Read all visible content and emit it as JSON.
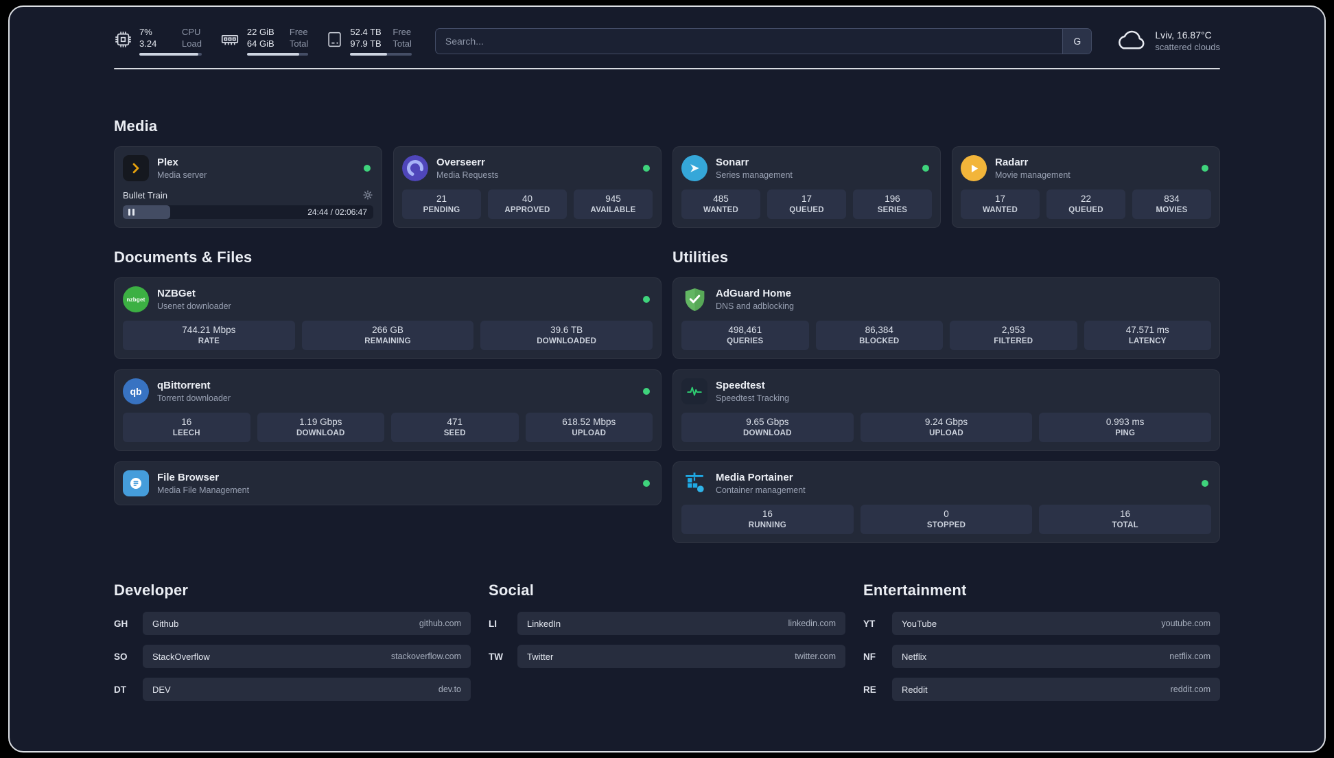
{
  "topbar": {
    "metrics": [
      {
        "icon": "cpu",
        "rows": [
          {
            "value": "7%",
            "label": "CPU"
          },
          {
            "value": "3.24",
            "label": "Load"
          }
        ],
        "bar_percent": 95
      },
      {
        "icon": "ram",
        "rows": [
          {
            "value": "22 GiB",
            "label": "Free"
          },
          {
            "value": "64 GiB",
            "label": "Total"
          }
        ],
        "bar_percent": 85
      },
      {
        "icon": "disk",
        "rows": [
          {
            "value": "52.4 TB",
            "label": "Free"
          },
          {
            "value": "97.9 TB",
            "label": "Total"
          }
        ],
        "bar_percent": 60
      }
    ],
    "search": {
      "placeholder": "Search...",
      "button_label": "G"
    },
    "weather": {
      "location": "Lviv, 16.87°C",
      "condition": "scattered clouds"
    }
  },
  "sections": {
    "media": {
      "title": "Media",
      "cards": [
        {
          "name": "Plex",
          "desc": "Media server",
          "icon": "plex",
          "online": true,
          "player": {
            "title": "Bullet Train",
            "time": "24:44 / 02:06:47",
            "progress_percent": 19
          }
        },
        {
          "name": "Overseerr",
          "desc": "Media Requests",
          "icon": "overseerr",
          "online": true,
          "stats": [
            {
              "value": "21",
              "label": "PENDING"
            },
            {
              "value": "40",
              "label": "APPROVED"
            },
            {
              "value": "945",
              "label": "AVAILABLE"
            }
          ]
        },
        {
          "name": "Sonarr",
          "desc": "Series management",
          "icon": "sonarr",
          "online": true,
          "stats": [
            {
              "value": "485",
              "label": "WANTED"
            },
            {
              "value": "17",
              "label": "QUEUED"
            },
            {
              "value": "196",
              "label": "SERIES"
            }
          ]
        },
        {
          "name": "Radarr",
          "desc": "Movie management",
          "icon": "radarr",
          "online": true,
          "stats": [
            {
              "value": "17",
              "label": "WANTED"
            },
            {
              "value": "22",
              "label": "QUEUED"
            },
            {
              "value": "834",
              "label": "MOVIES"
            }
          ]
        }
      ]
    },
    "documents": {
      "title": "Documents & Files",
      "cards": [
        {
          "name": "NZBGet",
          "desc": "Usenet downloader",
          "icon": "nzbget",
          "online": true,
          "stats": [
            {
              "value": "744.21 Mbps",
              "label": "RATE"
            },
            {
              "value": "266 GB",
              "label": "REMAINING"
            },
            {
              "value": "39.6 TB",
              "label": "DOWNLOADED"
            }
          ]
        },
        {
          "name": "qBittorrent",
          "desc": "Torrent downloader",
          "icon": "qbittorrent",
          "online": true,
          "stats": [
            {
              "value": "16",
              "label": "LEECH"
            },
            {
              "value": "1.19 Gbps",
              "label": "DOWNLOAD"
            },
            {
              "value": "471",
              "label": "SEED"
            },
            {
              "value": "618.52 Mbps",
              "label": "UPLOAD"
            }
          ]
        },
        {
          "name": "File Browser",
          "desc": "Media File Management",
          "icon": "filebrowser",
          "online": true
        }
      ]
    },
    "utilities": {
      "title": "Utilities",
      "cards": [
        {
          "name": "AdGuard Home",
          "desc": "DNS and adblocking",
          "icon": "adguard",
          "online": false,
          "stats": [
            {
              "value": "498,461",
              "label": "QUERIES"
            },
            {
              "value": "86,384",
              "label": "BLOCKED"
            },
            {
              "value": "2,953",
              "label": "FILTERED"
            },
            {
              "value": "47.571 ms",
              "label": "LATENCY"
            }
          ]
        },
        {
          "name": "Speedtest",
          "desc": "Speedtest Tracking",
          "icon": "speedtest",
          "online": false,
          "stats": [
            {
              "value": "9.65 Gbps",
              "label": "DOWNLOAD"
            },
            {
              "value": "9.24 Gbps",
              "label": "UPLOAD"
            },
            {
              "value": "0.993 ms",
              "label": "PING"
            }
          ]
        },
        {
          "name": "Media Portainer",
          "desc": "Container management",
          "icon": "portainer",
          "online": true,
          "stats": [
            {
              "value": "16",
              "label": "RUNNING"
            },
            {
              "value": "0",
              "label": "STOPPED"
            },
            {
              "value": "16",
              "label": "TOTAL"
            }
          ]
        }
      ]
    }
  },
  "link_sections": [
    {
      "title": "Developer",
      "items": [
        {
          "abbr": "GH",
          "name": "Github",
          "url": "github.com"
        },
        {
          "abbr": "SO",
          "name": "StackOverflow",
          "url": "stackoverflow.com"
        },
        {
          "abbr": "DT",
          "name": "DEV",
          "url": "dev.to"
        }
      ]
    },
    {
      "title": "Social",
      "items": [
        {
          "abbr": "LI",
          "name": "LinkedIn",
          "url": "linkedin.com"
        },
        {
          "abbr": "TW",
          "name": "Twitter",
          "url": "twitter.com"
        }
      ]
    },
    {
      "title": "Entertainment",
      "items": [
        {
          "abbr": "YT",
          "name": "YouTube",
          "url": "youtube.com"
        },
        {
          "abbr": "NF",
          "name": "Netflix",
          "url": "netflix.com"
        },
        {
          "abbr": "RE",
          "name": "Reddit",
          "url": "reddit.com"
        }
      ]
    }
  ],
  "colors": {
    "status_green": "#3fd37c",
    "plex": "#e5a00d",
    "overseerr": "#4f46ba",
    "overseerr_ring": "#a7b3f7",
    "sonarr": "#35a7d9",
    "radarr": "#f2b53a",
    "nzbget": "#3cb043",
    "qbittorrent": "#3873c2",
    "filebrowser": "#459ddb",
    "adguard": "#63b663",
    "speedtest_line": "#2ecc71",
    "portainer": "#1fa9e4"
  }
}
